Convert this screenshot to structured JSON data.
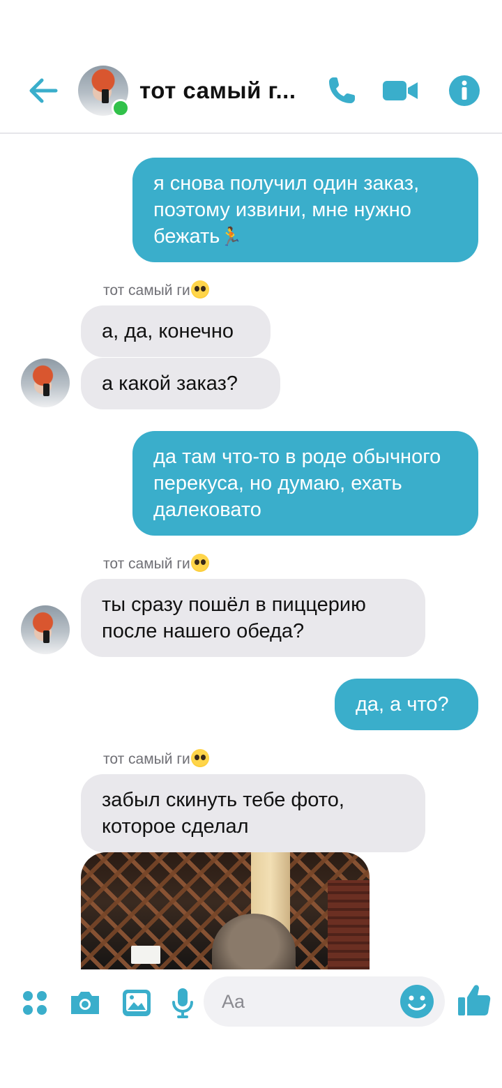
{
  "header": {
    "contact_name": "тот самый г...",
    "icons": [
      "back-arrow-icon",
      "phone-icon",
      "video-camera-icon",
      "info-icon"
    ],
    "accent_color": "#3aaecb"
  },
  "messages": [
    {
      "type": "out",
      "text": "я снова получил один заказ, поэтому извини, мне нужно бежать"
    },
    {
      "type": "sender",
      "text": "тот самый ги"
    },
    {
      "type": "in",
      "text": "а, да, конечно"
    },
    {
      "type": "in",
      "text": "а какой заказ?"
    },
    {
      "type": "out",
      "text": "да там что-то в роде обычного перекуса, но думаю, ехать далековато"
    },
    {
      "type": "sender",
      "text": "тот самый ги"
    },
    {
      "type": "in",
      "text": "ты сразу пошёл в пиццерию после нашего обеда?"
    },
    {
      "type": "out",
      "text": "да, а что?"
    },
    {
      "type": "sender",
      "text": "тот самый ги"
    },
    {
      "type": "in",
      "text": "забыл скинуть тебе фото, которое сделал"
    }
  ],
  "composer": {
    "placeholder": "Aa",
    "icons": [
      "apps-icon",
      "camera-icon",
      "gallery-icon",
      "microphone-icon",
      "emoji-icon",
      "thumbs-up-icon"
    ]
  }
}
